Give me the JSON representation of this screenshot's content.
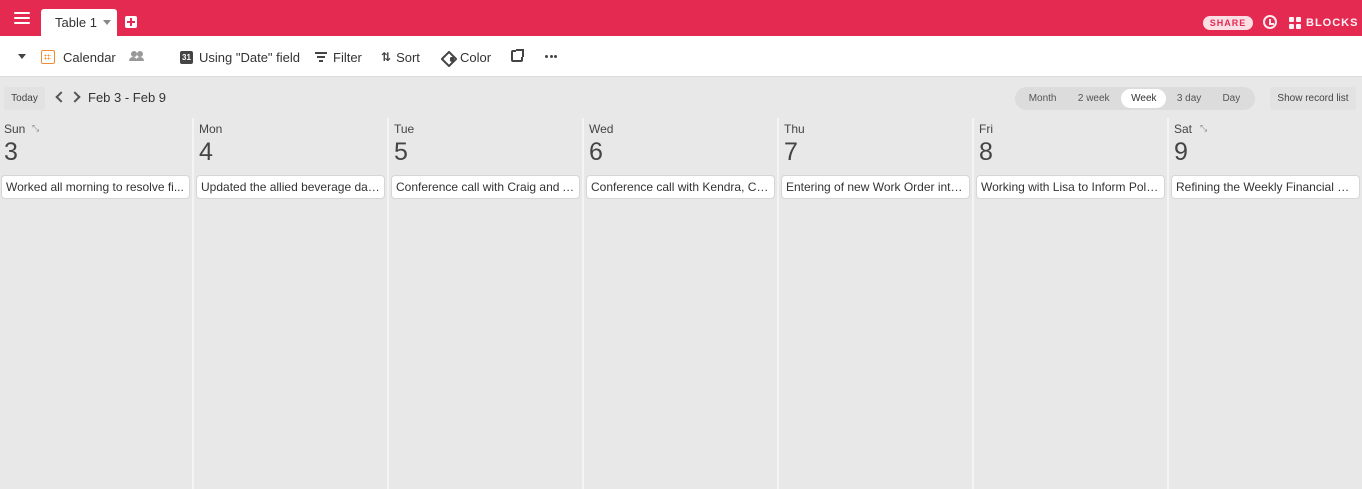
{
  "topbar": {
    "tab_label": "Table 1",
    "share_label": "SHARE",
    "blocks_label": "BLOCKS",
    "accent_color": "#e52a52"
  },
  "toolbar": {
    "view_name": "Calendar",
    "date_field_label": "Using \"Date\" field",
    "date_icon_text": "31",
    "filter_label": "Filter",
    "sort_label": "Sort",
    "color_label": "Color"
  },
  "calendar": {
    "today_label": "Today",
    "range_label": "Feb 3 - Feb 9",
    "modes": [
      "Month",
      "2 week",
      "Week",
      "3 day",
      "Day"
    ],
    "active_mode": "Week",
    "show_record_list_label": "Show record list",
    "days": [
      {
        "name": "Sun",
        "num": "3",
        "event": "Worked all morning to resolve fi..."
      },
      {
        "name": "Mon",
        "num": "4",
        "event": "Updated the allied beverage dat..."
      },
      {
        "name": "Tue",
        "num": "5",
        "event": "Conference call with Craig and A..."
      },
      {
        "name": "Wed",
        "num": "6",
        "event": "Conference call with Kendra, Crai..."
      },
      {
        "name": "Thu",
        "num": "7",
        "event": "Entering of new Work Order into..."
      },
      {
        "name": "Fri",
        "num": "8",
        "event": "Working with Lisa to Inform Polis..."
      },
      {
        "name": "Sat",
        "num": "9",
        "event": "Refining the Weekly Financial Re..."
      }
    ]
  }
}
